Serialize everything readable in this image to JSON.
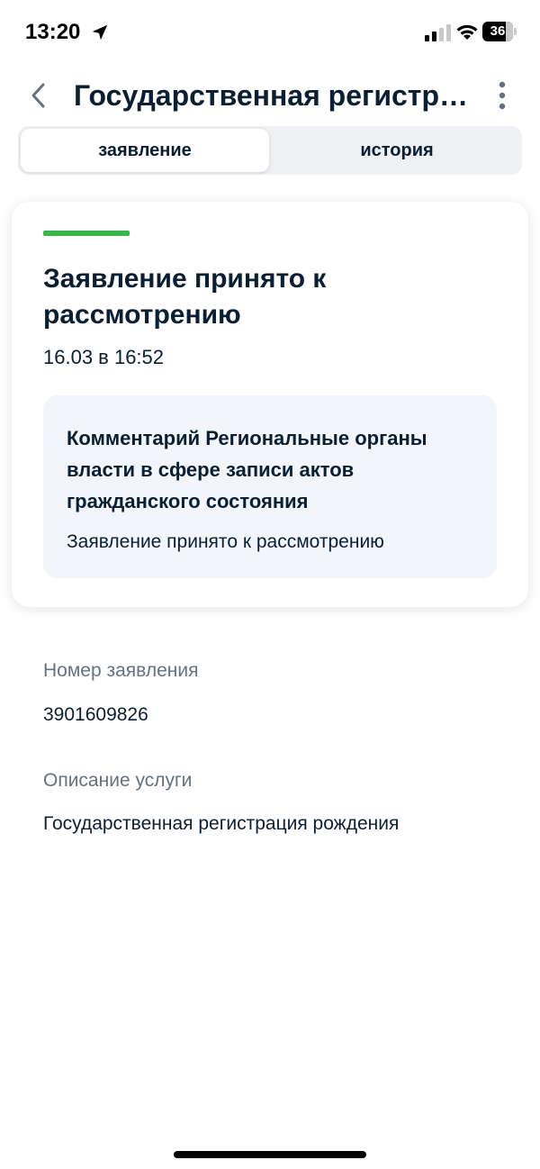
{
  "status_bar": {
    "time": "13:20",
    "battery": "36"
  },
  "header": {
    "title": "Государственная регистрация рождения"
  },
  "tabs": [
    {
      "label": "заявление",
      "active": true
    },
    {
      "label": "история",
      "active": false
    }
  ],
  "status_card": {
    "stripe_color": "#3ab54a",
    "title": "Заявление принято к рассмотрению",
    "date": "16.03 в 16:52",
    "comment": {
      "title": "Комментарий Региональные органы власти в сфере записи актов гражданского состояния",
      "text": "Заявление принято к рассмотрению"
    }
  },
  "details": {
    "number_label": "Номер заявления",
    "number_value": "3901609826",
    "description_label": "Описание услуги",
    "description_value": "Государственная регистрация рождения"
  }
}
